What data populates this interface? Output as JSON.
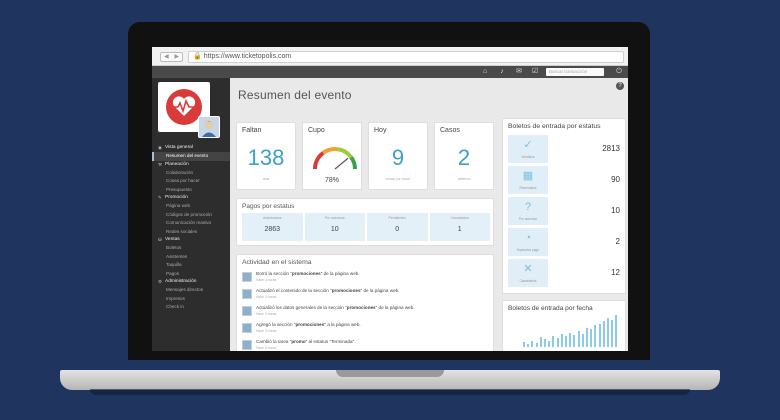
{
  "browser": {
    "url": "https://www.ticketopolis.com"
  },
  "topbar": {
    "search_placeholder": "Buscar transacción"
  },
  "sidebar": {
    "sections": [
      {
        "label": "Vista general",
        "items": [
          {
            "label": "Resumen del evento",
            "active": true
          }
        ]
      },
      {
        "label": "Planeación",
        "items": [
          {
            "label": "Colaboración"
          },
          {
            "label": "Cosas por hacer"
          },
          {
            "label": "Presupuesto"
          }
        ]
      },
      {
        "label": "Promoción",
        "items": [
          {
            "label": "Página web"
          },
          {
            "label": "Códigos de promoción"
          },
          {
            "label": "Comunicación masiva"
          },
          {
            "label": "Redes sociales"
          }
        ]
      },
      {
        "label": "Ventas",
        "items": [
          {
            "label": "Boletos"
          },
          {
            "label": "Asistentes"
          },
          {
            "label": "Taquilla"
          },
          {
            "label": "Pagos"
          }
        ]
      },
      {
        "label": "Administración",
        "items": [
          {
            "label": "Mensajes directos"
          },
          {
            "label": "Impresos"
          },
          {
            "label": "Check in"
          }
        ]
      }
    ]
  },
  "main": {
    "title": "Resumen del evento",
    "faltan": {
      "label": "Faltan",
      "value": "138",
      "unit": "días"
    },
    "cupo": {
      "label": "Cupo",
      "value": "78%",
      "percent": 78
    },
    "hoy": {
      "label": "Hoy",
      "value": "9",
      "sub": "cosas por hacer"
    },
    "casos": {
      "label": "Casos",
      "value": "2",
      "sub": "abiertos"
    },
    "pagos": {
      "title": "Pagos por estatus",
      "columns": [
        {
          "label": "Autorizados",
          "value": "2863"
        },
        {
          "label": "Por autorizar",
          "value": "10"
        },
        {
          "label": "Pendientes",
          "value": "0"
        },
        {
          "label": "Cancelados",
          "value": "1"
        }
      ]
    },
    "actividad": {
      "title": "Actividad en el sistema",
      "items": [
        {
          "pre": "Borró la sección \"",
          "bold": "promociones",
          "post": "\" de la página web.",
          "time": "Hace 3 horas"
        },
        {
          "pre": "Actualizó el contenido de la sección \"",
          "bold": "promociones",
          "post": "\" de la página web.",
          "time": "Hace 3 horas"
        },
        {
          "pre": "Actualizó los datos generales de la sección \"",
          "bold": "promociones",
          "post": "\" de la página web.",
          "time": "Hace 3 horas"
        },
        {
          "pre": "Agregó la sección \"",
          "bold": "promociones",
          "post": "\" a la página web.",
          "time": "Hace 3 horas"
        },
        {
          "pre": "Cambió la tarea \"",
          "bold": "promo",
          "post": "\" al estatus \"Terminada\".",
          "time": "Hace 4 horas"
        }
      ]
    },
    "estatus": {
      "title": "Boletos de entrada por estatus",
      "rows": [
        {
          "name": "Vendidos",
          "value": "2813",
          "icon": "check-icon"
        },
        {
          "name": "Reservados",
          "value": "90",
          "icon": "calendar-icon"
        },
        {
          "name": "Por autorizar",
          "value": "10",
          "icon": "question-icon"
        },
        {
          "name": "Expirados pago",
          "value": "2",
          "icon": "clock-icon"
        },
        {
          "name": "Cancelados",
          "value": "12",
          "icon": "x-icon"
        }
      ]
    },
    "fecha": {
      "title": "Boletos de entrada por fecha",
      "bars": [
        0.15,
        0.1,
        0.2,
        0.12,
        0.3,
        0.25,
        0.18,
        0.35,
        0.28,
        0.4,
        0.33,
        0.45,
        0.38,
        0.5,
        0.42,
        0.6,
        0.55,
        0.68,
        0.72,
        0.8,
        0.9,
        0.85,
        1.0
      ]
    }
  }
}
